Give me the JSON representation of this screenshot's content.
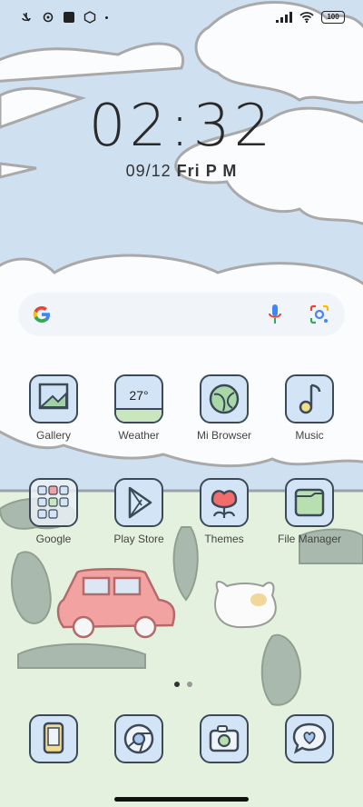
{
  "status_bar": {
    "left_icons": [
      "muted-mic-icon",
      "settings-gear-icon",
      "square-notification-icon",
      "mi-badge-icon",
      "dot-icon"
    ],
    "battery": "100"
  },
  "clock": {
    "time": "02:32"
  },
  "date": {
    "date": "09/12",
    "day": "Fri",
    "ampm": "P M"
  },
  "search": {
    "provider": "Google"
  },
  "apps": [
    {
      "label": "Gallery",
      "icon": "gallery-icon"
    },
    {
      "label": "Weather",
      "icon": "weather-icon",
      "text": "27°"
    },
    {
      "label": "Mi Browser",
      "icon": "browser-icon"
    },
    {
      "label": "Music",
      "icon": "music-icon"
    },
    {
      "label": "Google",
      "icon": "google-folder-icon"
    },
    {
      "label": "Play Store",
      "icon": "play-store-icon"
    },
    {
      "label": "Themes",
      "icon": "themes-icon"
    },
    {
      "label": "File Manager",
      "icon": "file-manager-icon"
    }
  ],
  "dock": [
    "phone-icon",
    "chrome-icon",
    "camera-icon",
    "messages-icon"
  ],
  "pager": {
    "pages": 2,
    "current": 1
  },
  "colors": {
    "sky": "#cfe0f1",
    "grass": "#e4f1de",
    "outline": "#3c4a58",
    "icon_bg": "#d3e4f6",
    "icon_grass": "#c9e6bf"
  }
}
